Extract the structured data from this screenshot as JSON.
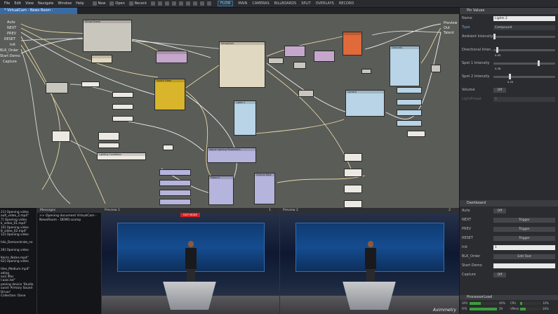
{
  "menubar": {
    "items": [
      "File",
      "Edit",
      "View",
      "Navigate",
      "Window",
      "Help"
    ],
    "toolbar": [
      "New",
      "Open",
      "Recent"
    ],
    "modes": [
      "FLOW",
      "MAIN",
      "CAMERAS",
      "BILLBOARDS",
      "SPLIT",
      "OVERLAYS",
      "RECORD"
    ],
    "selected_mode": "FLOW"
  },
  "tab": {
    "label": "* VirtualCam - News Room - DEMO.scomp"
  },
  "canvas": {
    "left_ports": [
      "Auto",
      "NEXT",
      "PREV",
      "RESET",
      "Init",
      "BLK_Order",
      "Start Demo",
      "Capture"
    ],
    "right_ports": [
      "Preview",
      "Out",
      "Talent"
    ],
    "node_titles": [
      "Virtual Scene",
      "VirtualCam",
      "Lights 2",
      "Switch Video",
      "Channels",
      "Cutscene",
      "Lighting Conditions",
      "Adjust Lighting Parameters",
      "Video In",
      "Cinema Data",
      "Camera"
    ],
    "exit_mode_label": "EXIT MODE"
  },
  "props": {
    "title": "Pin Values",
    "rows": [
      {
        "label": "Name",
        "value": "Lights 2"
      },
      {
        "label": "Type",
        "value": "Compound"
      },
      {
        "label": "Ambient Intensity",
        "value": "0"
      },
      {
        "label": "Directional Inten...",
        "value": "0.05"
      },
      {
        "label": "Spot 1 Intensity",
        "value": "0.26"
      },
      {
        "label": "Spot 2 Intensity",
        "value": "0.25"
      },
      {
        "label": "Volume",
        "value": "Off"
      },
      {
        "label": "LightPreset",
        "value": "0"
      }
    ],
    "levels": {
      "ambient": 0.0,
      "directional": 0.05,
      "spot1": 0.72,
      "spot2": 0.25
    }
  },
  "dashboard": {
    "title": "Dashboard",
    "rows": [
      {
        "label": "Auto",
        "value": "Off"
      },
      {
        "label": "NEXT",
        "value": "Trigger"
      },
      {
        "label": "PREV",
        "value": "Trigger"
      },
      {
        "label": "RESET",
        "value": "Trigger"
      },
      {
        "label": "Init",
        "value": "1"
      },
      {
        "label": "BLK_Order",
        "value": "Edit Text"
      },
      {
        "label": "Start Demo",
        "value": ""
      },
      {
        "label": "Capture",
        "value": "Off"
      }
    ]
  },
  "processor": {
    "title": "ProcessorLoad",
    "rows": [
      {
        "label": "GPU",
        "value": "40%"
      },
      {
        "label": "FPS",
        "value": "59"
      },
      {
        "label": "CPU",
        "value": "10%"
      },
      {
        "label": "VMem",
        "value": "26%"
      }
    ],
    "levels": {
      "gpu": 0.4,
      "fps": 0.98,
      "cpu": 0.1,
      "vmem": 0.26
    }
  },
  "log": {
    "lines": [
      "21] Opening video",
      "ault_video_2.mp4\"",
      "7] Opening video",
      "k_video_01.mp4\"",
      "10] Opening video",
      "8_video_02.mp4\"",
      "12] Opening video",
      "",
      "hilo_Demonstrate_ne",
      "",
      "26] Opening video",
      "",
      "Keirin_Notes.mp4\"",
      "62] Opening video",
      "",
      "tiles_Medium.mp4\"",
      "ading",
      "ion] iffec",
      "l:axei.txt\"",
      "pening device 'Studio",
      "ound: Primary Sound",
      "Driver'",
      "Collection: Done"
    ]
  },
  "messages": {
    "title": "Messages",
    "text": ">> Opening document VirtualCam - NewsRoom - DEMO.scomp"
  },
  "preview1": {
    "title": "Preview 1",
    "number": "1"
  },
  "preview2": {
    "title": "Preview 2",
    "number": "2"
  },
  "watermark": "Aximmetry"
}
